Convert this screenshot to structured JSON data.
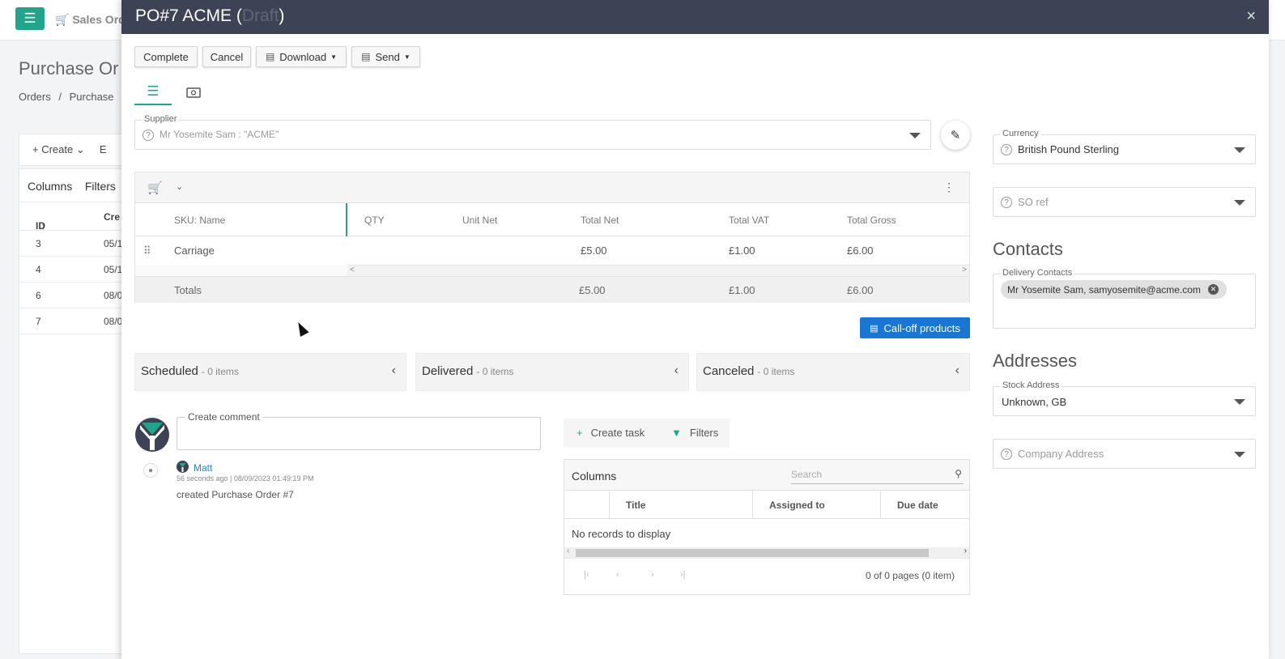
{
  "background": {
    "nav_label": "Sales Orde",
    "page_title": "Purchase Or",
    "breadcrumb": [
      "Orders",
      "/",
      "Purchase"
    ],
    "create_label": "Create",
    "extra_label": "E",
    "grid_tabs": [
      "Columns",
      "Filters"
    ],
    "grid_headers": [
      "ID",
      "Cre"
    ],
    "rows": [
      {
        "id": "3",
        "date": "05/1"
      },
      {
        "id": "4",
        "date": "05/1"
      },
      {
        "id": "6",
        "date": "08/0"
      },
      {
        "id": "7",
        "date": "08/0"
      }
    ]
  },
  "modal": {
    "title_main": "PO#7 ACME (",
    "title_status": "Draft",
    "title_end": ")",
    "close_glyph": "×"
  },
  "toolbar": {
    "complete": "Complete",
    "cancel": "Cancel",
    "download": "Download",
    "send": "Send"
  },
  "supplier": {
    "label": "Supplier",
    "value": "Mr Yosemite Sam : \"ACME\""
  },
  "lines": {
    "headers": [
      "SKU: Name",
      "QTY",
      "Unit Net",
      "Total Net",
      "Total VAT",
      "Total Gross"
    ],
    "rows": [
      {
        "name": "Carriage",
        "qty": "",
        "unit_net": "",
        "total_net": "£5.00",
        "total_vat": "£1.00",
        "total_gross": "£6.00"
      }
    ],
    "totals": {
      "label": "Totals",
      "total_net": "£5.00",
      "total_vat": "£1.00",
      "total_gross": "£6.00"
    }
  },
  "calloff_label": "Call-off products",
  "panels": [
    {
      "title": "Scheduled",
      "count": "- 0 items"
    },
    {
      "title": "Delivered",
      "count": "- 0 items"
    },
    {
      "title": "Canceled",
      "count": "- 0 items"
    }
  ],
  "comments": {
    "field_label": "Create comment",
    "entries": [
      {
        "user": "Matt",
        "meta": "56 seconds ago | 08/09/2023 01:49:19 PM",
        "text": "created Purchase Order #7"
      }
    ]
  },
  "tasks": {
    "create": "Create task",
    "filters": "Filters",
    "columns": "Columns",
    "search_placeholder": "Search",
    "headers": [
      "Title",
      "Assigned to",
      "Due date"
    ],
    "empty": "No records to display",
    "pager_info": "0 of 0 pages (0 item)"
  },
  "right": {
    "currency_label": "Currency",
    "currency_value": "British Pound Sterling",
    "so_ref": "SO ref",
    "contacts_heading": "Contacts",
    "delivery_contacts_label": "Delivery Contacts",
    "contact_chip": "Mr Yosemite Sam, samyosemite@acme.com",
    "addresses_heading": "Addresses",
    "stock_label": "Stock Address",
    "stock_value": "Unknown, GB",
    "company_address": "Company Address"
  },
  "colors": {
    "accent": "#20a58a",
    "header_bg": "#3d4355",
    "primary_button": "#1976d2"
  }
}
